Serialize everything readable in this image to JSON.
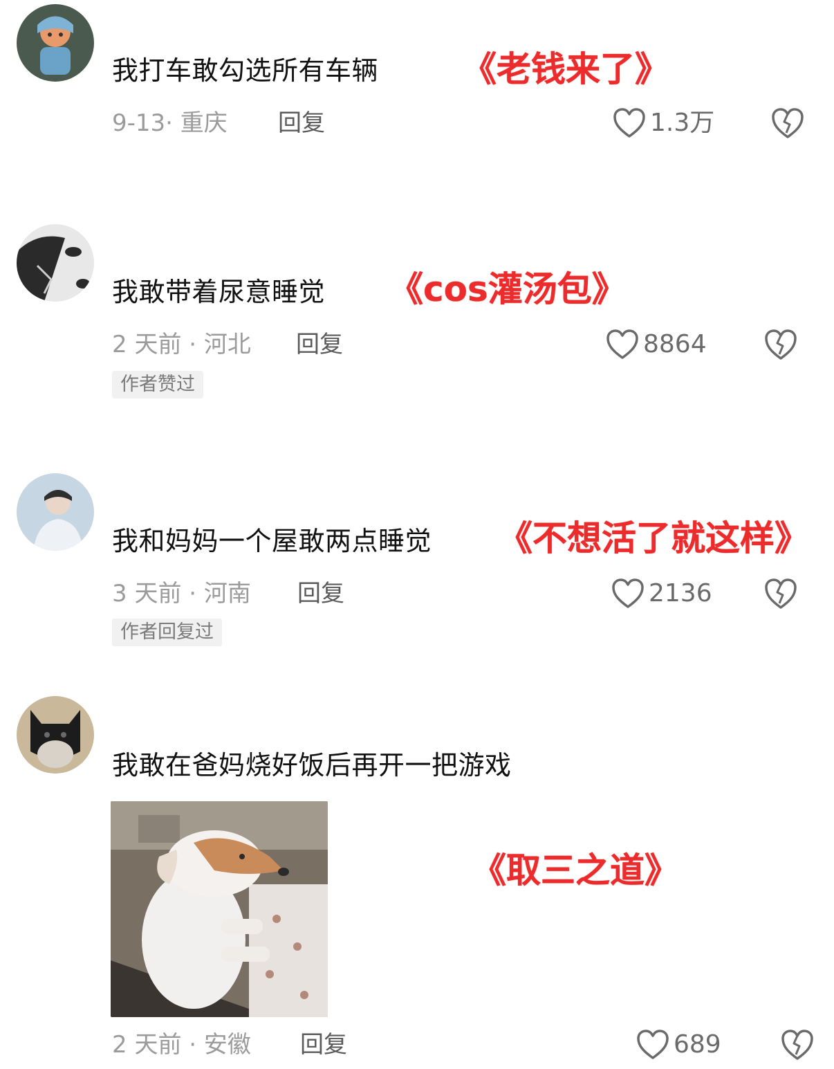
{
  "comments": [
    {
      "text": "我打车敢勾选所有车辆",
      "annotation": "《老钱来了》",
      "date_location": "9-13· 重庆",
      "reply_label": "回复",
      "likes": "1.3万",
      "badge": ""
    },
    {
      "text": "我敢带着尿意睡觉",
      "annotation": "《cos灌汤包》",
      "date_location": "2 天前 · 河北",
      "reply_label": "回复",
      "likes": "8864",
      "badge": "作者赞过"
    },
    {
      "text": "我和妈妈一个屋敢两点睡觉",
      "annotation": "《不想活了就这样》",
      "date_location": "3 天前 · 河南",
      "reply_label": "回复",
      "likes": "2136",
      "badge": "作者回复过"
    },
    {
      "text": "我敢在爸妈烧好饭后再开一把游戏",
      "annotation": "《取三之道》",
      "date_location": "2 天前 · 安徽",
      "reply_label": "回复",
      "likes": "689",
      "badge": ""
    }
  ],
  "icons": {
    "like": "heart-outline-icon",
    "dislike": "broken-heart-icon"
  },
  "colors": {
    "annotation": "#ec2c2c",
    "meta": "#9b9b9b",
    "reply": "#5a5a5a",
    "badge_bg": "#f1f1f1"
  }
}
